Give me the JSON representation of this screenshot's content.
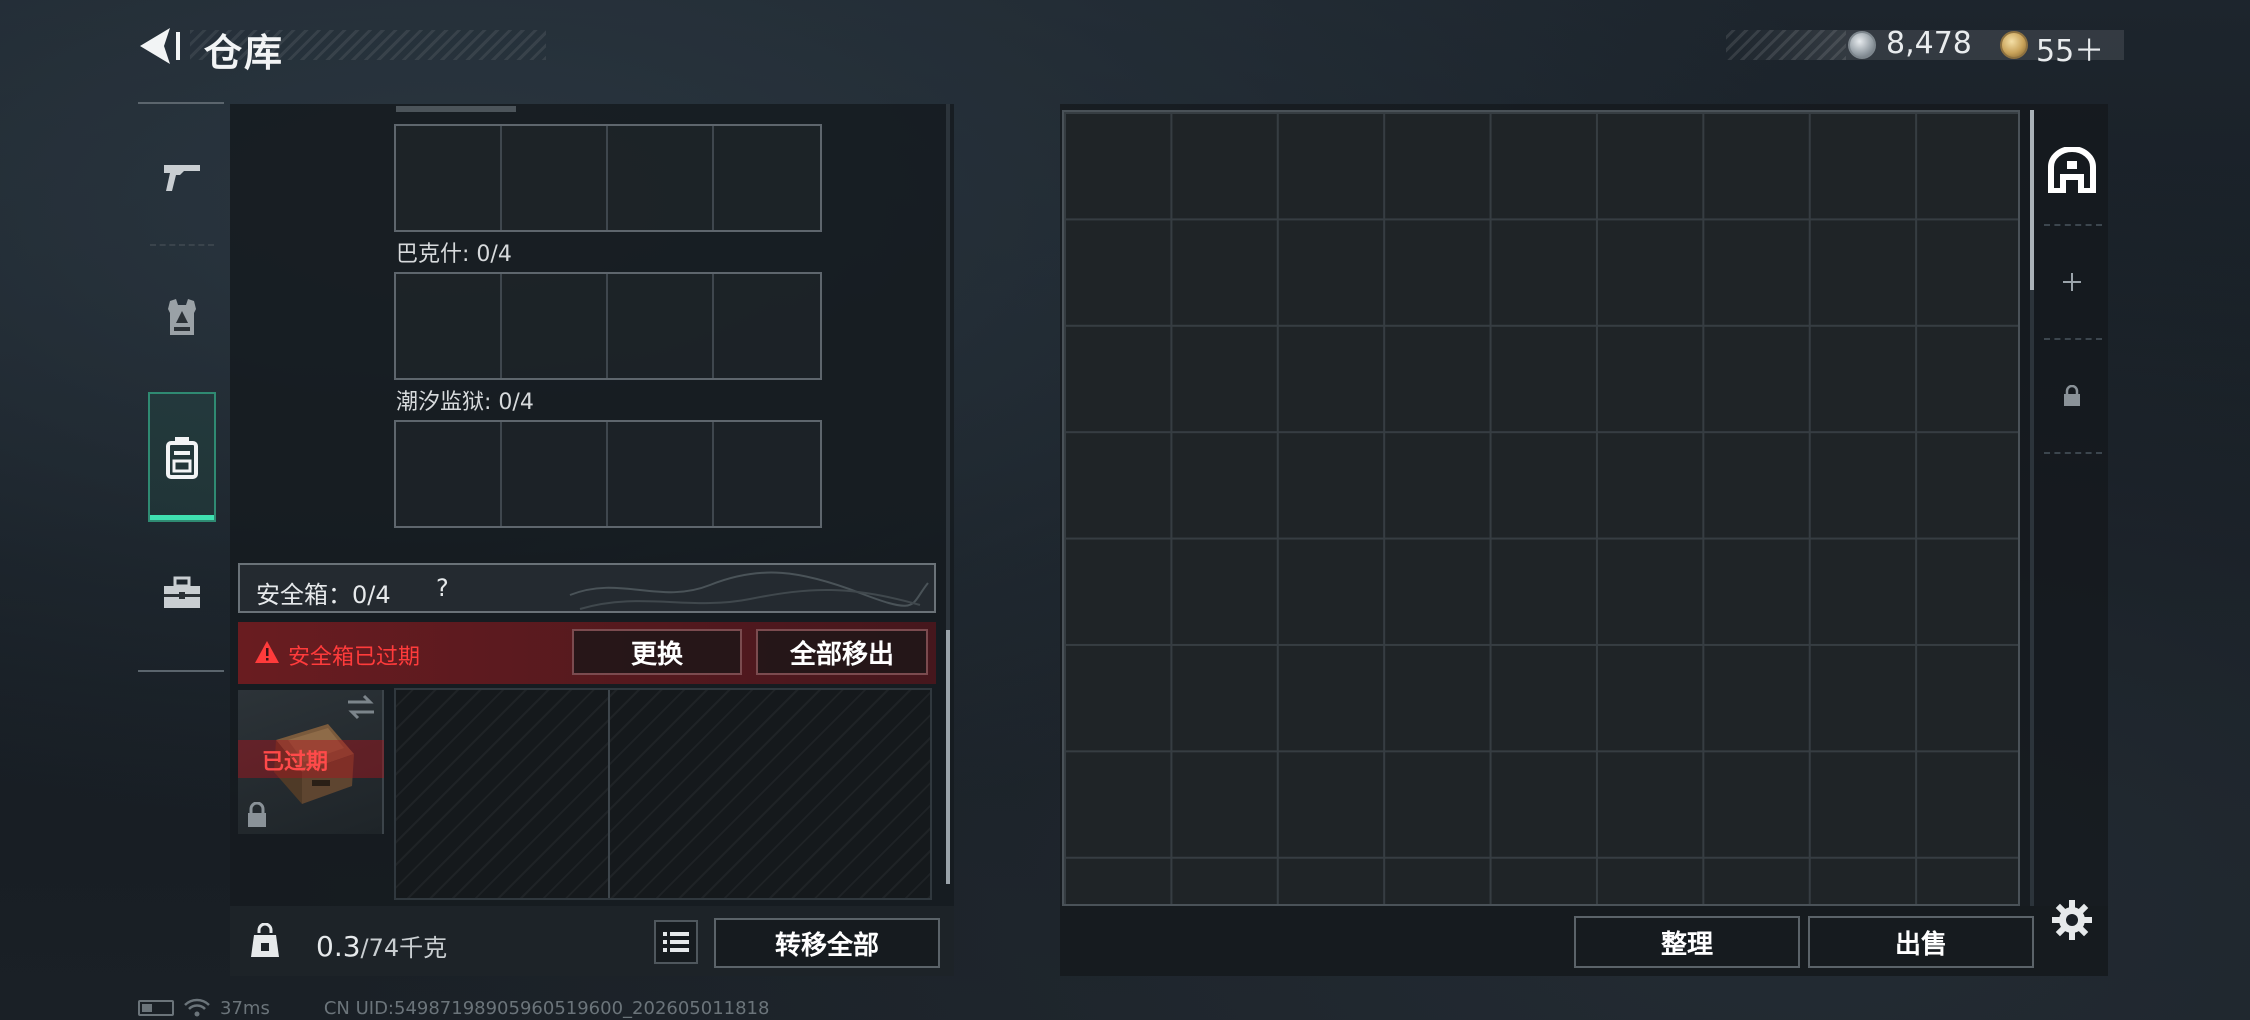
{
  "header": {
    "title": "仓库",
    "currencies": [
      {
        "name": "silver-coin",
        "value": "8,478",
        "color": "#c5ccd1"
      },
      {
        "name": "gold-coin",
        "value": "55＋",
        "color": "#c9a35a"
      }
    ]
  },
  "sidebar": {
    "categories": [
      {
        "icon": "pistol-icon",
        "active": false
      },
      {
        "icon": "vest-icon",
        "active": false
      },
      {
        "icon": "backpack-icon",
        "active": true
      },
      {
        "icon": "toolbox-icon",
        "active": false
      }
    ]
  },
  "inventory": {
    "sections": [
      {
        "label": "巴克什: 0/4"
      },
      {
        "label": "潮汐监狱: 0/4"
      }
    ],
    "safebox": {
      "title": "安全箱：0/4",
      "help": "?",
      "warning": "安全箱已过期",
      "replace_label": "更换",
      "remove_all_label": "全部移出",
      "case_badge": "已过期"
    },
    "weight": {
      "current": "0.3",
      "capacity": "/74千克"
    },
    "transfer_all_label": "转移全部"
  },
  "storage": {
    "sort_label": "整理",
    "sell_label": "出售"
  },
  "status": {
    "ping": "37ms",
    "uid": "CN UID:54987198905960519600_202605011818"
  },
  "colors": {
    "accent": "#3fe0b0",
    "warning": "#ff3b3b"
  }
}
